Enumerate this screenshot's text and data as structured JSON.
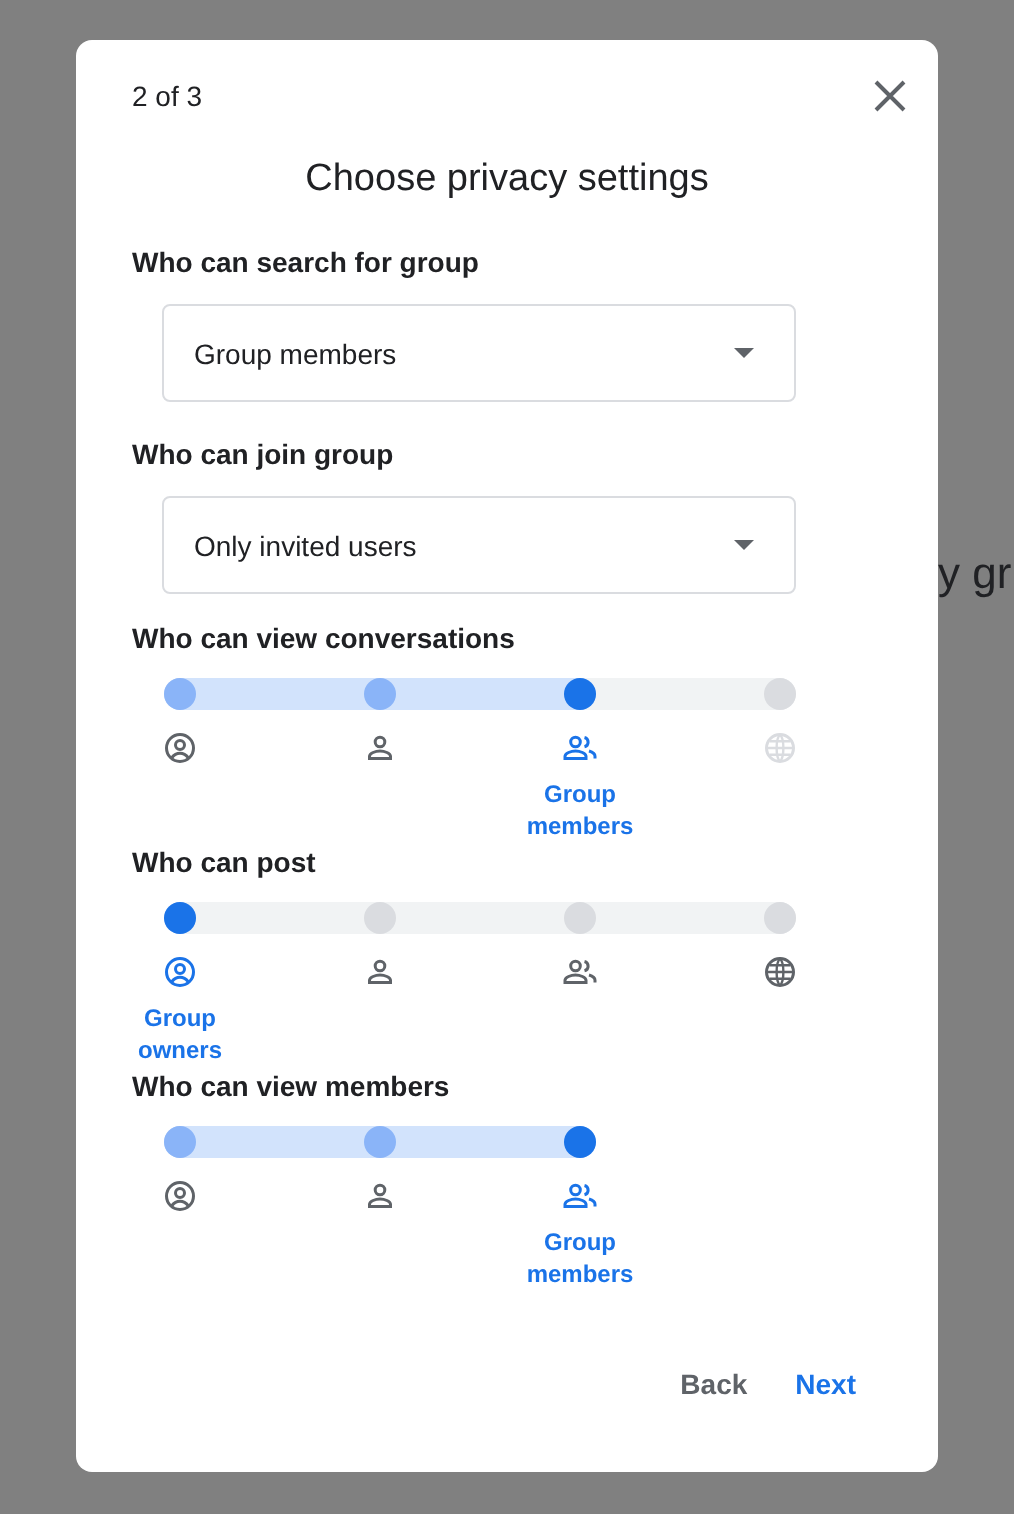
{
  "background_text": "y gr",
  "dialog": {
    "step": "2 of 3",
    "title": "Choose privacy settings",
    "dropdowns": [
      {
        "label": "Who can search for group",
        "value": "Group members"
      },
      {
        "label": "Who can join group",
        "value": "Only invited users"
      }
    ],
    "sliders": [
      {
        "label": "Who can view conversations",
        "stops": [
          {
            "kind": "owner",
            "selected": false,
            "disabled": false
          },
          {
            "kind": "user",
            "selected": false,
            "disabled": false
          },
          {
            "kind": "group",
            "selected": true,
            "disabled": false,
            "caption": "Group members"
          },
          {
            "kind": "public",
            "selected": false,
            "disabled": true
          }
        ]
      },
      {
        "label": "Who can post",
        "stops": [
          {
            "kind": "owner",
            "selected": true,
            "disabled": false,
            "caption": "Group owners"
          },
          {
            "kind": "user",
            "selected": false,
            "disabled": false
          },
          {
            "kind": "group",
            "selected": false,
            "disabled": false
          },
          {
            "kind": "public",
            "selected": false,
            "disabled": false
          }
        ]
      },
      {
        "label": "Who can view members",
        "stops": [
          {
            "kind": "owner",
            "selected": false,
            "disabled": false
          },
          {
            "kind": "user",
            "selected": false,
            "disabled": false
          },
          {
            "kind": "group",
            "selected": true,
            "disabled": false,
            "caption": "Group members"
          }
        ]
      }
    ],
    "buttons": [
      {
        "label": "Back",
        "kind": "secondary"
      },
      {
        "label": "Next",
        "kind": "primary"
      }
    ]
  }
}
